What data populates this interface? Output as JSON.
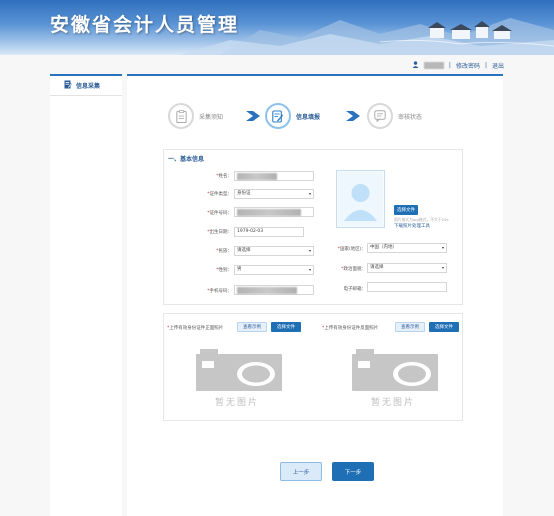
{
  "header": {
    "title": "安徽省会计人员管理",
    "change_password": "修改密码",
    "logout": "退出",
    "separator": "|"
  },
  "sidebar": {
    "items": [
      {
        "label": "信息采集"
      }
    ]
  },
  "steps": [
    {
      "label": "采集须知",
      "state": "done"
    },
    {
      "label": "信息填报",
      "state": "active"
    },
    {
      "label": "审核状态",
      "state": "pending"
    }
  ],
  "basic_info": {
    "section_title": "一、基本信息",
    "name_label": "姓名：",
    "id_type_label": "证件类型：",
    "id_type_value": "身份证",
    "id_number_label": "证件号码：",
    "birth_label": "出生日期：",
    "birth_value": "1979-02-03",
    "nation_label": "民族：",
    "nation_value": "请选择",
    "country_label": "国家(地区)：",
    "country_value": "中国（内地）",
    "gender_label": "性别：",
    "gender_value": "男",
    "politics_label": "政治面貌：",
    "politics_value": "请选择",
    "phone_label": "手机号码：",
    "email_label": "电子邮箱：",
    "required_mark": "*",
    "photo_button": "选择文件",
    "photo_hint": "照片格式为jpg格式，不大于20k",
    "photo_tool_link": "下载照片处理工具"
  },
  "id_upload": {
    "front_label": "上传有效身份证件正面照片",
    "back_label": "上传有效身份证件反面照片",
    "view_sample": "查看示例",
    "choose_file": "选择文件",
    "no_image": "暂无图片"
  },
  "buttons": {
    "prev": "上一步",
    "next": "下一步"
  },
  "colors": {
    "accent": "#1f6fb5",
    "link": "#2c5d98",
    "required": "#e02020"
  }
}
